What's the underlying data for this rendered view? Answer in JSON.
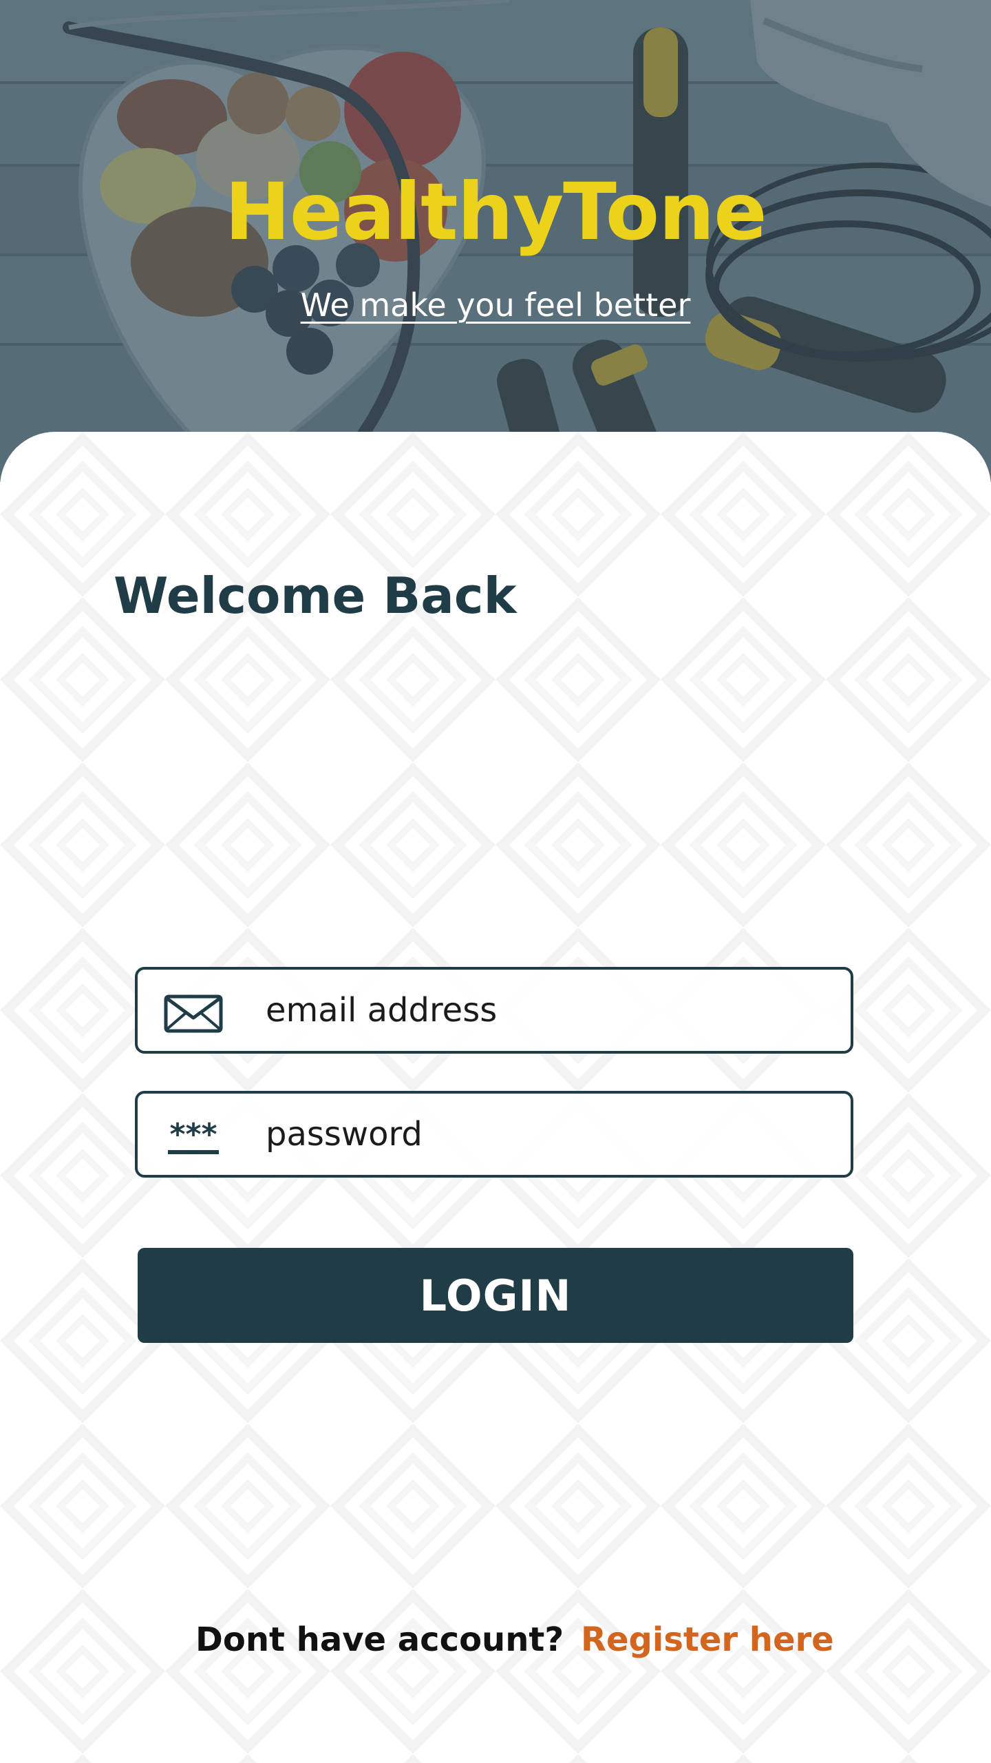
{
  "app": {
    "title": "HealthyTone",
    "tagline": "We make you feel better"
  },
  "login_form": {
    "heading": "Welcome Back",
    "email": {
      "placeholder": "email address",
      "value": "",
      "icon": "envelope-icon"
    },
    "password": {
      "placeholder": "password",
      "value": "",
      "icon": "password-asterisks-icon"
    },
    "login_label": "LOGIN"
  },
  "register": {
    "prompt": "Dont have account?",
    "link_label": "Register here"
  },
  "colors": {
    "brand_yellow": "#ECD21A",
    "primary_dark": "#1F3C47",
    "link_orange": "#D2661E"
  }
}
